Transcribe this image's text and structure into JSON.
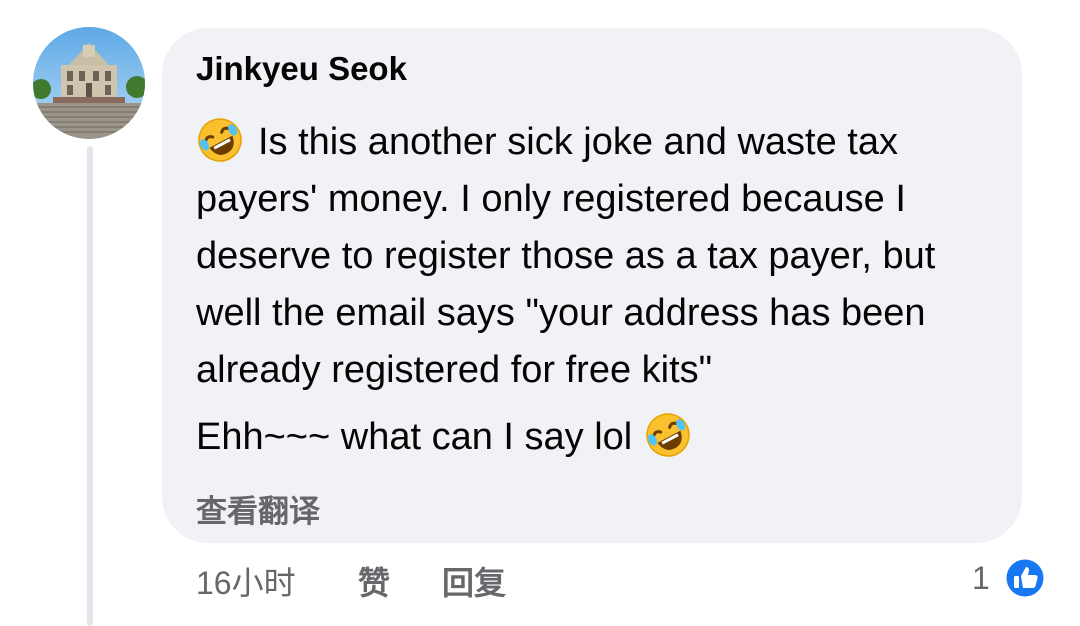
{
  "comment": {
    "author": "Jinkyeu Seok",
    "paragraph_1": "Is this another sick joke and waste tax payers' money. I only registered because I deserve to register those as a tax payer, but well the email says \"your address has been already registered for free kits\"",
    "paragraph_2": "Ehh~~~ what can I say lol",
    "emoji_icon": "rolling-on-floor-laughing-emoji",
    "see_translation": "查看翻译"
  },
  "meta": {
    "time": "16小时",
    "like_label": "赞",
    "reply_label": "回复"
  },
  "reactions": {
    "count": "1",
    "icon": "thumbs-up-icon",
    "badge_color": "#1877f2"
  },
  "colors": {
    "bubble_bg": "#f0f2f5",
    "secondary_text": "#65676b",
    "thread_line": "#e4e6eb"
  }
}
